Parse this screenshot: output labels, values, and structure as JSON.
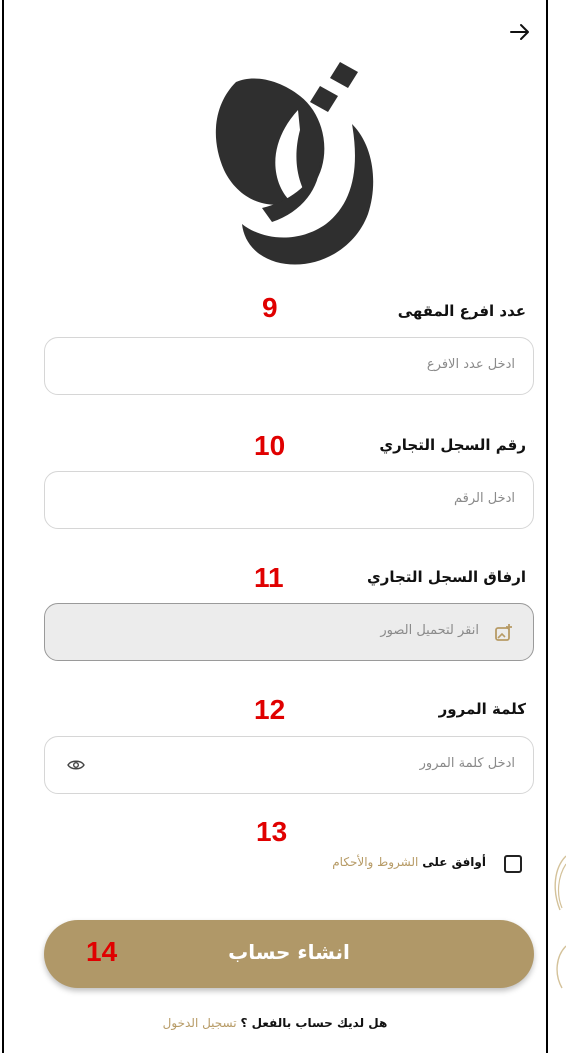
{
  "header": {
    "back_icon": "arrow-right-icon"
  },
  "logo": {
    "icon": "brand-calligraphy-logo"
  },
  "fields": {
    "branches": {
      "label": "عدد افرع المقهى",
      "placeholder": "ادخل عدد الافرع",
      "marker": "9"
    },
    "registry_number": {
      "label": "رقم السجل التجاري",
      "placeholder": "ادخل الرقم",
      "marker": "10"
    },
    "registry_attachment": {
      "label": "ارفاق السجل التجاري",
      "placeholder": "انقر لتحميل الصور",
      "marker": "11",
      "icon": "image-upload-icon"
    },
    "password": {
      "label": "كلمة المرور",
      "placeholder": "ادخل كلمة المرور",
      "marker": "12",
      "icon": "eye-icon"
    }
  },
  "terms": {
    "prefix": "أوافق على",
    "link": "الشروط والأحكام",
    "marker": "13"
  },
  "submit": {
    "label": "انشاء حساب",
    "marker": "14"
  },
  "footer": {
    "question": "هل لديك حساب بالفعل ؟",
    "link": "تسجيل الدخول"
  },
  "colors": {
    "accent": "#b09868",
    "link": "#b79b66",
    "marker": "#e00000"
  }
}
